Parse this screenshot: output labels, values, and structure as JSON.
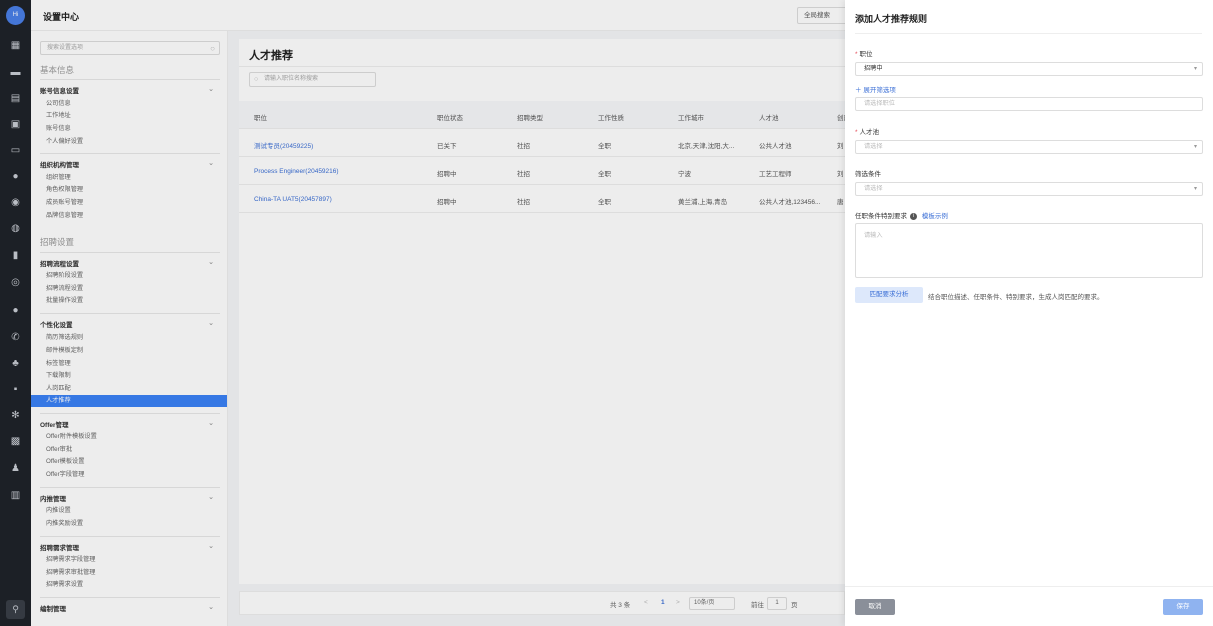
{
  "app": {
    "title": "设置中心",
    "global_search": "全局搜索",
    "logo_text": "Hi"
  },
  "sidebar": {
    "search_placeholder": "搜索设置选项",
    "group_basic": "基本信息",
    "sec_account": {
      "title": "账号信息设置",
      "items": [
        "公司信息",
        "工作地址",
        "账号信息",
        "个人偏好设置"
      ]
    },
    "sec_org": {
      "title": "组织机构管理",
      "items": [
        "组织管理",
        "角色权限管理",
        "成员账号管理",
        "品牌信息管理"
      ]
    },
    "group_recruit": "招聘设置",
    "sec_process": {
      "title": "招聘流程设置",
      "items": [
        "招聘阶段设置",
        "招聘流程设置",
        "批量操作设置"
      ]
    },
    "sec_personal": {
      "title": "个性化设置",
      "items": [
        "简历筛选规则",
        "邮件模板定制",
        "标签管理",
        "下载限制",
        "人岗匹配",
        "人才推荐"
      ]
    },
    "sec_offer": {
      "title": "Offer管理",
      "items": [
        "Offer附件模板设置",
        "Offer审批",
        "Offer模板设置",
        "Offer字段管理"
      ]
    },
    "sec_referral": {
      "title": "内推管理",
      "items": [
        "内推设置",
        "内推奖励设置"
      ]
    },
    "sec_demand": {
      "title": "招聘需求管理",
      "items": [
        "招聘需求字段管理",
        "招聘需求审批管理",
        "招聘需求设置"
      ]
    },
    "sec_staff": {
      "title": "编制管理"
    }
  },
  "main": {
    "title": "人才推荐",
    "search_placeholder": "请输入职位名称搜索",
    "columns": [
      "职位",
      "职位状态",
      "招聘类型",
      "工作性质",
      "工作城市",
      "人才池",
      "创建人"
    ],
    "rows": [
      [
        "测试专员(20459225)",
        "已关下",
        "社招",
        "全职",
        "北京,天津,沈阳,大...",
        "公共人才池",
        "刘"
      ],
      [
        "Process Engineer(20459216)",
        "招聘中",
        "社招",
        "全职",
        "宁波",
        "工艺工程师",
        "刘"
      ],
      [
        "China-TA UAT5(20457897)",
        "招聘中",
        "社招",
        "全职",
        "黄兰浦,上海,青岛",
        "公共人才池,123456...",
        "唐"
      ]
    ],
    "pager": {
      "total": "共 3 条",
      "prev": "<",
      "page": "1",
      "next": ">",
      "size": "10条/页",
      "goto": "前往",
      "goto_page": "1",
      "page_unit": "页"
    }
  },
  "drawer": {
    "title": "添加人才推荐规则",
    "position_label": "职位",
    "position_status": "招聘中",
    "expand_filter": "展开筛选项",
    "position_placeholder": "请选择职位",
    "pool_label": "人才池",
    "pool_placeholder": "请选择",
    "filter_label": "筛选条件",
    "filter_placeholder": "请选择",
    "requirement_label": "任职条件特别要求",
    "example_link": "模板示例",
    "requirement_placeholder": "请输入",
    "analyze_button": "匹配要求分析",
    "analyze_hint": "结合职位描述、任职条件、特别要求，生成人岗匹配的要求。",
    "cancel": "取消",
    "save": "保存"
  },
  "colors": {
    "accent": "#3b82f6",
    "rail": "#1f2329",
    "link": "#3b6fd6"
  }
}
